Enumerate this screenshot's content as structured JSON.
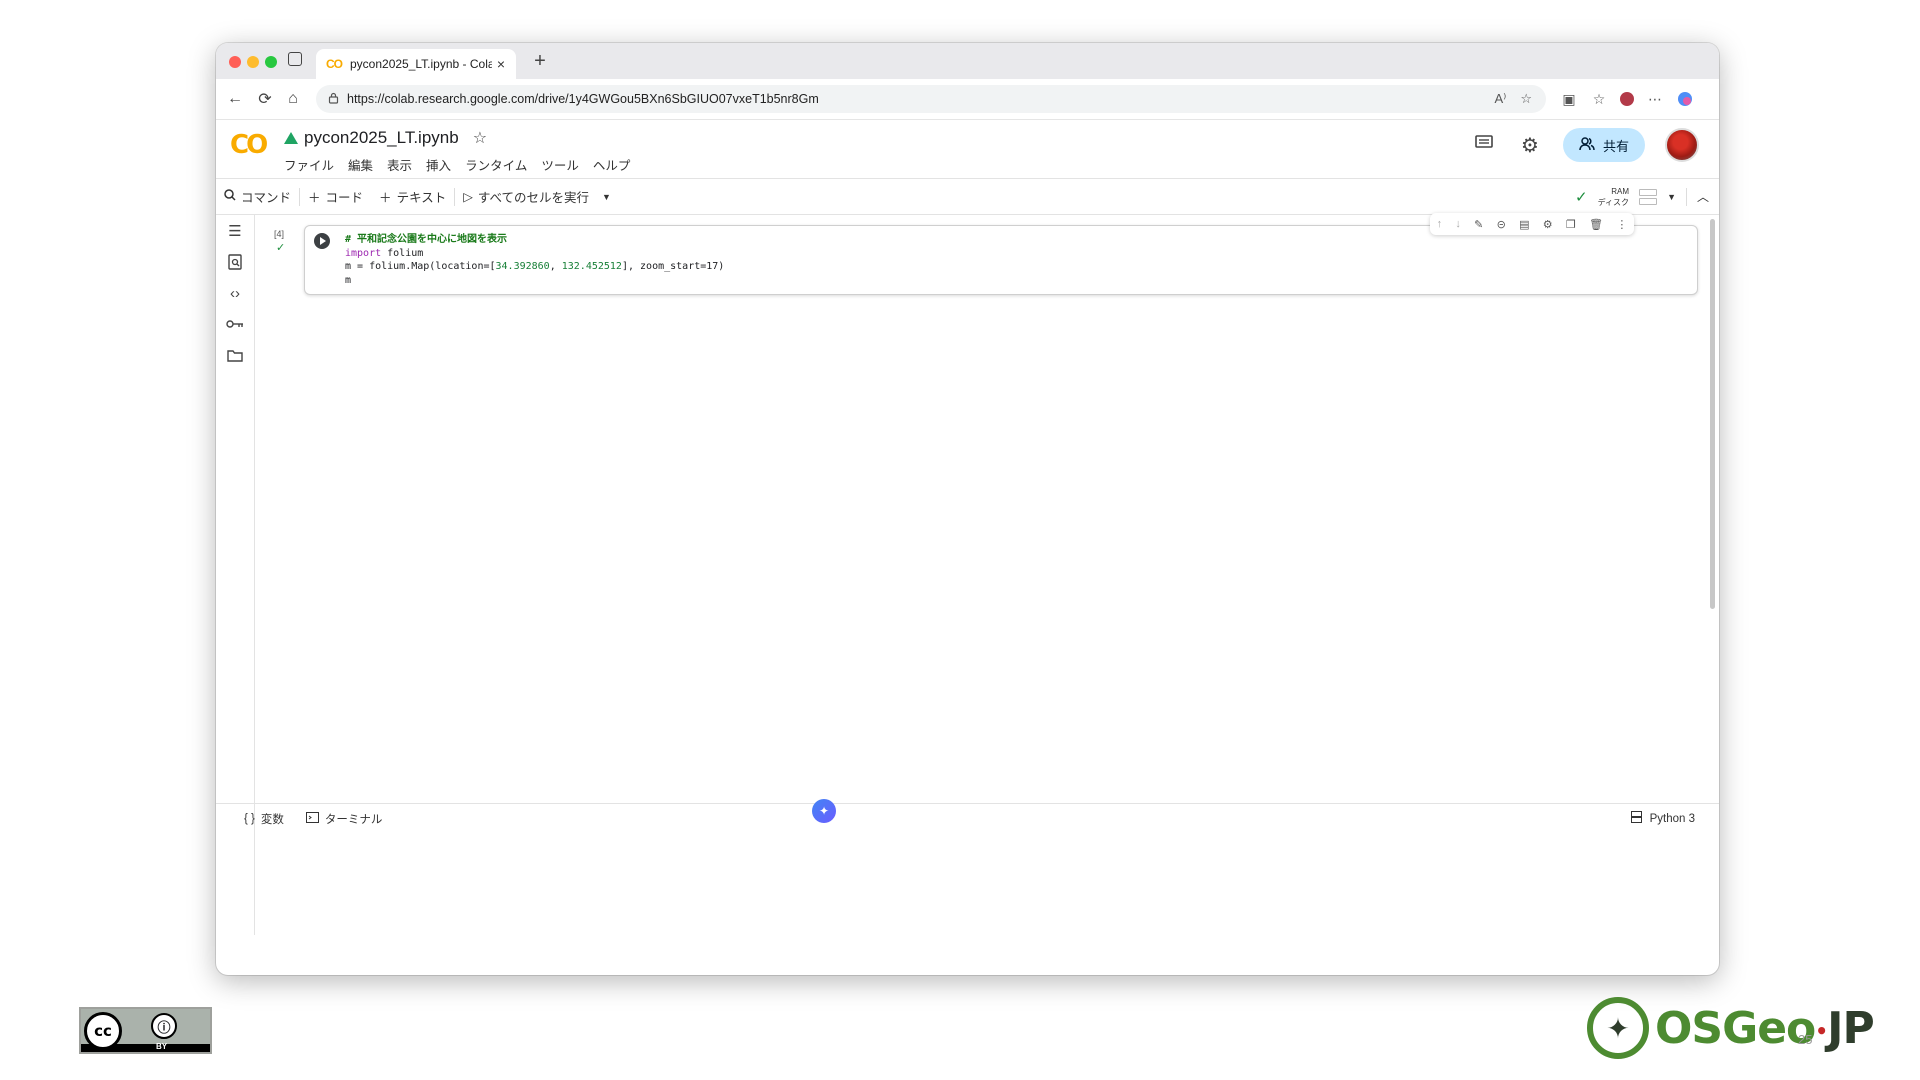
{
  "browser": {
    "tab_favicon": "CO",
    "tab_title": "pycon2025_LT.ipynb - Colab",
    "close_glyph": "×",
    "newtab_glyph": "+",
    "url": "https://colab.research.google.com/drive/1y4GWGou5BXn6SbGIUO07vxeT1b5nr8Gm"
  },
  "colab": {
    "logo": "CO",
    "notebook_title": "pycon2025_LT.ipynb",
    "menu": [
      "ファイル",
      "編集",
      "表示",
      "挿入",
      "ランタイム",
      "ツール",
      "ヘルプ"
    ],
    "share_label": "共有"
  },
  "toolbar": {
    "command_label": "コマンド",
    "code_label": "コード",
    "text_label": "テキスト",
    "run_all_label": "すべてのセルを実行",
    "ram_label": "RAM",
    "disk_label": "ディスク"
  },
  "cell": {
    "exec_count": "[4]",
    "code_line1": "# 平和記念公園を中心に地図を表示",
    "code_line2_kw": "import",
    "code_line2_rest": " folium",
    "code_line3_pre": "m = folium.Map(location=[",
    "code_line3_lat": "34.392860",
    "code_line3_mid": ", ",
    "code_line3_lon": "132.452512",
    "code_line3_post": "], zoom_start=17)",
    "code_line4": "m"
  },
  "bottom": {
    "variables_label": "変数",
    "terminal_label": "ターミナル",
    "runtime_label": "Python 3"
  },
  "slide": {
    "cc_label": "cc",
    "by_label": "BY",
    "osgeo_main": "OSGeo",
    "osgeo_jp": "JP",
    "page_number": "25"
  },
  "icons": {
    "list": "table-of-contents-icon",
    "find": "find-icon",
    "code": "code-snippets-icon",
    "key": "secrets-icon",
    "folder": "files-icon"
  },
  "colors": {
    "accent": "#f9ab00",
    "share_bg": "#c2e7ff",
    "osgeo_green": "#4d8b31"
  }
}
